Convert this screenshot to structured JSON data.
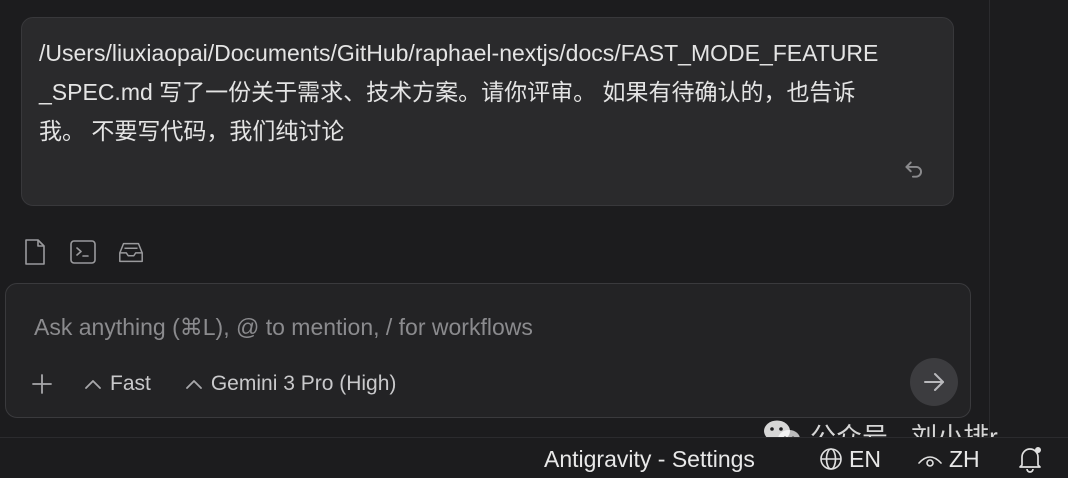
{
  "message": {
    "text": "/Users/liuxiaopai/Documents/GitHub/raphael-nextjs/docs/FAST_MODE_FEATURE_SPEC.md 写了一份关于需求、技术方案。请你评审。 如果有待确认的，也告诉我。 不要写代码，我们纯讨论",
    "undo_icon": "undo-icon"
  },
  "attachments": {
    "icons": [
      "file-icon",
      "terminal-icon",
      "inbox-icon"
    ]
  },
  "input": {
    "placeholder": "Ask anything (⌘L), @ to mention, / for workflows",
    "value": ""
  },
  "toolbar": {
    "add_icon": "plus-icon",
    "mode_label": "Fast",
    "model_label": "Gemini 3 Pro (High)",
    "send_icon": "arrow-right-icon"
  },
  "status_bar": {
    "settings_label": "Antigravity - Settings",
    "language_label": "EN",
    "view_label": "ZH",
    "bell_icon": "bell-icon"
  },
  "watermark": {
    "text": "公众号 · 刘小排r",
    "icon": "wechat-icon"
  },
  "colors": {
    "background": "#1c1c1e",
    "bubble": "#2a2a2c",
    "input_bg": "#232325",
    "text": "#e4e4e4",
    "muted": "#8b8b8e"
  }
}
